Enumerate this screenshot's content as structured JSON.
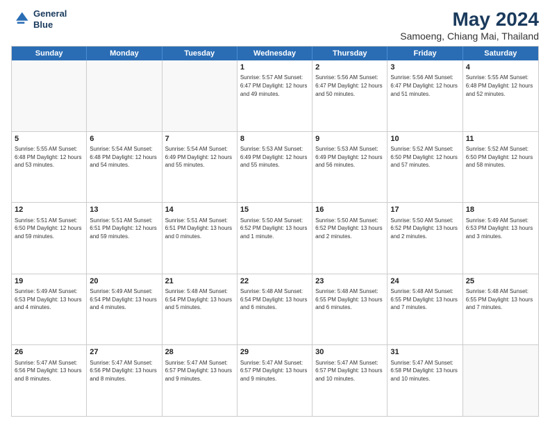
{
  "header": {
    "logo_line1": "General",
    "logo_line2": "Blue",
    "month_year": "May 2024",
    "location": "Samoeng, Chiang Mai, Thailand"
  },
  "day_headers": [
    "Sunday",
    "Monday",
    "Tuesday",
    "Wednesday",
    "Thursday",
    "Friday",
    "Saturday"
  ],
  "rows": [
    [
      {
        "date": "",
        "content": ""
      },
      {
        "date": "",
        "content": ""
      },
      {
        "date": "",
        "content": ""
      },
      {
        "date": "1",
        "content": "Sunrise: 5:57 AM\nSunset: 6:47 PM\nDaylight: 12 hours\nand 49 minutes."
      },
      {
        "date": "2",
        "content": "Sunrise: 5:56 AM\nSunset: 6:47 PM\nDaylight: 12 hours\nand 50 minutes."
      },
      {
        "date": "3",
        "content": "Sunrise: 5:56 AM\nSunset: 6:47 PM\nDaylight: 12 hours\nand 51 minutes."
      },
      {
        "date": "4",
        "content": "Sunrise: 5:55 AM\nSunset: 6:48 PM\nDaylight: 12 hours\nand 52 minutes."
      }
    ],
    [
      {
        "date": "5",
        "content": "Sunrise: 5:55 AM\nSunset: 6:48 PM\nDaylight: 12 hours\nand 53 minutes."
      },
      {
        "date": "6",
        "content": "Sunrise: 5:54 AM\nSunset: 6:48 PM\nDaylight: 12 hours\nand 54 minutes."
      },
      {
        "date": "7",
        "content": "Sunrise: 5:54 AM\nSunset: 6:49 PM\nDaylight: 12 hours\nand 55 minutes."
      },
      {
        "date": "8",
        "content": "Sunrise: 5:53 AM\nSunset: 6:49 PM\nDaylight: 12 hours\nand 55 minutes."
      },
      {
        "date": "9",
        "content": "Sunrise: 5:53 AM\nSunset: 6:49 PM\nDaylight: 12 hours\nand 56 minutes."
      },
      {
        "date": "10",
        "content": "Sunrise: 5:52 AM\nSunset: 6:50 PM\nDaylight: 12 hours\nand 57 minutes."
      },
      {
        "date": "11",
        "content": "Sunrise: 5:52 AM\nSunset: 6:50 PM\nDaylight: 12 hours\nand 58 minutes."
      }
    ],
    [
      {
        "date": "12",
        "content": "Sunrise: 5:51 AM\nSunset: 6:50 PM\nDaylight: 12 hours\nand 59 minutes."
      },
      {
        "date": "13",
        "content": "Sunrise: 5:51 AM\nSunset: 6:51 PM\nDaylight: 12 hours\nand 59 minutes."
      },
      {
        "date": "14",
        "content": "Sunrise: 5:51 AM\nSunset: 6:51 PM\nDaylight: 13 hours\nand 0 minutes."
      },
      {
        "date": "15",
        "content": "Sunrise: 5:50 AM\nSunset: 6:52 PM\nDaylight: 13 hours\nand 1 minute."
      },
      {
        "date": "16",
        "content": "Sunrise: 5:50 AM\nSunset: 6:52 PM\nDaylight: 13 hours\nand 2 minutes."
      },
      {
        "date": "17",
        "content": "Sunrise: 5:50 AM\nSunset: 6:52 PM\nDaylight: 13 hours\nand 2 minutes."
      },
      {
        "date": "18",
        "content": "Sunrise: 5:49 AM\nSunset: 6:53 PM\nDaylight: 13 hours\nand 3 minutes."
      }
    ],
    [
      {
        "date": "19",
        "content": "Sunrise: 5:49 AM\nSunset: 6:53 PM\nDaylight: 13 hours\nand 4 minutes."
      },
      {
        "date": "20",
        "content": "Sunrise: 5:49 AM\nSunset: 6:54 PM\nDaylight: 13 hours\nand 4 minutes."
      },
      {
        "date": "21",
        "content": "Sunrise: 5:48 AM\nSunset: 6:54 PM\nDaylight: 13 hours\nand 5 minutes."
      },
      {
        "date": "22",
        "content": "Sunrise: 5:48 AM\nSunset: 6:54 PM\nDaylight: 13 hours\nand 6 minutes."
      },
      {
        "date": "23",
        "content": "Sunrise: 5:48 AM\nSunset: 6:55 PM\nDaylight: 13 hours\nand 6 minutes."
      },
      {
        "date": "24",
        "content": "Sunrise: 5:48 AM\nSunset: 6:55 PM\nDaylight: 13 hours\nand 7 minutes."
      },
      {
        "date": "25",
        "content": "Sunrise: 5:48 AM\nSunset: 6:55 PM\nDaylight: 13 hours\nand 7 minutes."
      }
    ],
    [
      {
        "date": "26",
        "content": "Sunrise: 5:47 AM\nSunset: 6:56 PM\nDaylight: 13 hours\nand 8 minutes."
      },
      {
        "date": "27",
        "content": "Sunrise: 5:47 AM\nSunset: 6:56 PM\nDaylight: 13 hours\nand 8 minutes."
      },
      {
        "date": "28",
        "content": "Sunrise: 5:47 AM\nSunset: 6:57 PM\nDaylight: 13 hours\nand 9 minutes."
      },
      {
        "date": "29",
        "content": "Sunrise: 5:47 AM\nSunset: 6:57 PM\nDaylight: 13 hours\nand 9 minutes."
      },
      {
        "date": "30",
        "content": "Sunrise: 5:47 AM\nSunset: 6:57 PM\nDaylight: 13 hours\nand 10 minutes."
      },
      {
        "date": "31",
        "content": "Sunrise: 5:47 AM\nSunset: 6:58 PM\nDaylight: 13 hours\nand 10 minutes."
      },
      {
        "date": "",
        "content": ""
      }
    ]
  ]
}
